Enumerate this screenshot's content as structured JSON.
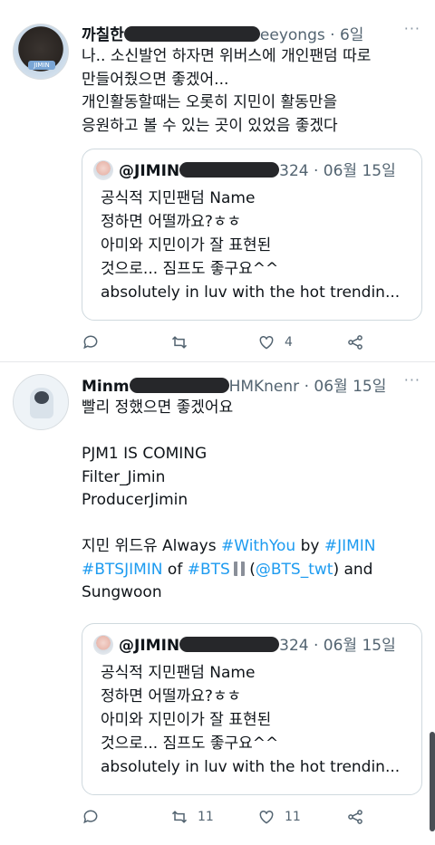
{
  "tweet1": {
    "name": "까칠한",
    "handle_tail": "eeyongs",
    "sep": "·",
    "time": "6일",
    "more": "···",
    "avatar_badge": "JIMIN",
    "lines": [
      "나.. 소신발언 하자면 위버스에 개인팬덤 따로",
      "만들어줬으면 좋겠어...",
      "개인활동할때는 오롯히 지민이 활동만을",
      "응원하고 볼 수 있는 곳이 있었음 좋겠다"
    ],
    "quote": {
      "name": "@JIMIN",
      "handle_tail": "324",
      "sep": "·",
      "time": "06월 15일",
      "lines": [
        "공식적 지민팬덤 Name",
        "정하면 어떨까요?ㅎㅎ",
        "아미와 지민이가 잘 표현된",
        "것으로... 짐프도 좋구요^^",
        "absolutely in luv with the hot trendin..."
      ]
    },
    "actions": {
      "reply": "",
      "retweet": "",
      "like": "4",
      "share": ""
    }
  },
  "tweet2": {
    "name": "Minm",
    "handle_tail": "HMKnenr",
    "sep": "·",
    "time": "06월 15일",
    "more": "···",
    "lines": [
      "빨리 정했으면 좋겠어요",
      "",
      "PJM1 IS COMING",
      "Filter_Jimin",
      "ProducerJimin",
      ""
    ],
    "rich": {
      "part1": "지민 위드유 Always ",
      "tag1": "#WithYou",
      "part2": " by ",
      "tag2": "#JIMIN",
      "tag3": "#BTSJIMIN",
      "part3": " of ",
      "tag4": "#BTS",
      "paren_open": " (",
      "mention": "@BTS_twt",
      "part4": ") and",
      "last": "Sungwoon"
    },
    "quote": {
      "name": "@JIMIN",
      "handle_tail": "324",
      "sep": "·",
      "time": "06월 15일",
      "lines": [
        "공식적 지민팬덤 Name",
        "정하면 어떨까요?ㅎㅎ",
        "아미와 지민이가 잘 표현된",
        "것으로... 짐프도 좋구요^^",
        "absolutely in luv with the hot trendin..."
      ]
    },
    "actions": {
      "reply": "",
      "retweet": "11",
      "like": "11",
      "share": ""
    }
  },
  "colors": {
    "link": "#1d9bf0",
    "muted": "#536471",
    "text": "#0f1419",
    "border": "#cfd9de"
  },
  "icons": [
    "reply-icon",
    "retweet-icon",
    "heart-icon",
    "share-icon",
    "more-icon"
  ]
}
